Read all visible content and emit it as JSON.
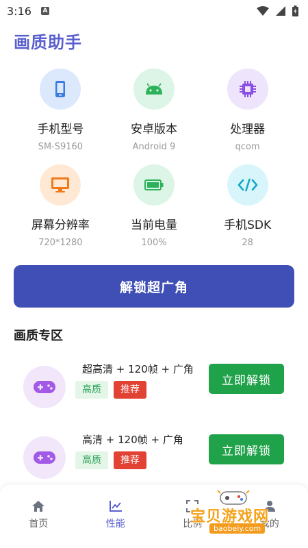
{
  "status": {
    "time": "3:16",
    "badge": "A"
  },
  "app": {
    "title": "画质助手"
  },
  "info": [
    {
      "label": "手机型号",
      "value": "SM-S9160",
      "icon": "phone-icon",
      "bg": "#dce8fb",
      "fg": "#3d7be0"
    },
    {
      "label": "安卓版本",
      "value": "Android 9",
      "icon": "android-icon",
      "bg": "#ddf5e6",
      "fg": "#2db25c"
    },
    {
      "label": "处理器",
      "value": "qcom",
      "icon": "cpu-icon",
      "bg": "#eee4fb",
      "fg": "#8a4fe0"
    },
    {
      "label": "屏幕分辨率",
      "value": "720*1280",
      "icon": "monitor-icon",
      "bg": "#ffe9d5",
      "fg": "#f07a1a"
    },
    {
      "label": "当前电量",
      "value": "100%",
      "icon": "battery-icon",
      "bg": "#ddf5e6",
      "fg": "#2db25c"
    },
    {
      "label": "手机SDK",
      "value": "28",
      "icon": "code-icon",
      "bg": "#d8f5fb",
      "fg": "#15a8c8"
    }
  ],
  "unlock_wide_label": "解锁超广角",
  "section": {
    "title": "画质专区"
  },
  "cards": [
    {
      "title": "超高清 + 120帧 + 广角",
      "tag1": "高质",
      "tag2": "推荐",
      "button": "立即解锁"
    },
    {
      "title": "高清 + 120帧 + 广角",
      "tag1": "高质",
      "tag2": "推荐",
      "button": "立即解锁"
    }
  ],
  "nav": [
    {
      "label": "首页",
      "icon": "home-icon"
    },
    {
      "label": "性能",
      "icon": "chart-icon"
    },
    {
      "label": "比例",
      "icon": "crop-icon"
    },
    {
      "label": "我的",
      "icon": "user-icon"
    }
  ],
  "watermark": {
    "text": "宝贝游戏网",
    "url": "baobeiy.com"
  },
  "colors": {
    "accent": "#5a5fcf",
    "primary_button": "#3f4fb5",
    "unlock_green": "#20a24a",
    "tag_red": "#e14234"
  }
}
